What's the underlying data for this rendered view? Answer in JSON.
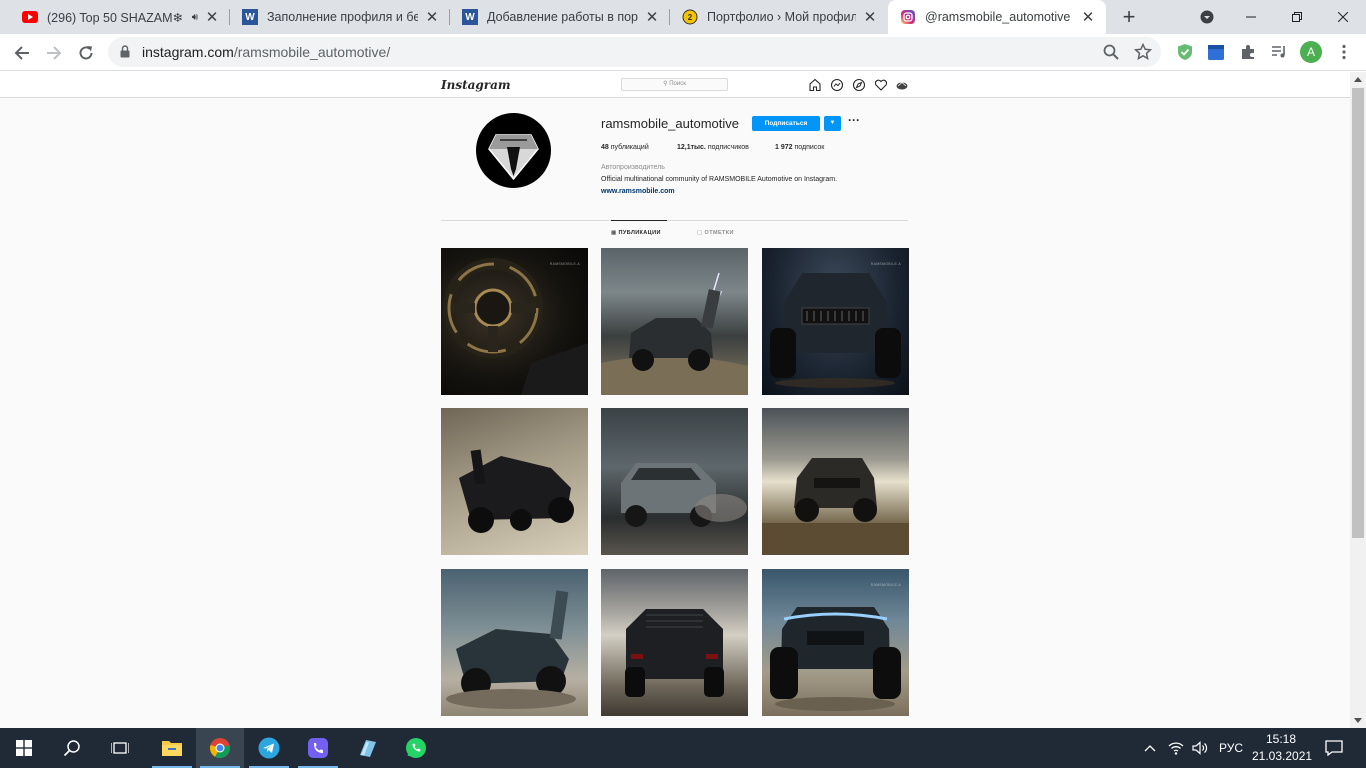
{
  "browser": {
    "tabs": [
      {
        "title": "(296) Top 50 SHAZAM❄",
        "favicon": "youtube-icon",
        "audio": true
      },
      {
        "title": "Заполнение профиля и бесплатная",
        "favicon": "word-icon"
      },
      {
        "title": "Добавление работы в портфолио",
        "favicon": "word-icon"
      },
      {
        "title": "Портфолио › Мой профиль",
        "favicon": "freelance-icon"
      },
      {
        "title": "@ramsmobile_automotive • Фото",
        "favicon": "instagram-icon",
        "active": true
      }
    ],
    "url_host": "instagram.com",
    "url_path": "/ramsmobile_automotive/",
    "profile_initial": "A"
  },
  "instagram": {
    "logo": "Instagram",
    "search_placeholder": "Поиск",
    "username": "ramsmobile_automotive",
    "follow_label": "Подписаться",
    "more_label": "···",
    "stats": {
      "posts_value": "48",
      "posts_label": "публикаций",
      "followers_value": "12,1тыс.",
      "followers_label": "подписчиков",
      "following_value": "1 972",
      "following_label": "подписок"
    },
    "category": "Автопроизводитель",
    "bio": "Official multinational community of RAMSMOBILE Automotive on Instagram.",
    "website": "www.ramsmobile.com",
    "tabs": {
      "posts": "ПУБЛИКАЦИИ",
      "tagged": "ОТМЕТКИ"
    },
    "watermark": "RAMSMOBILE.A",
    "posts": [
      {
        "subject": "steering-wheel"
      },
      {
        "subject": "offroad-vehicle-lightning"
      },
      {
        "subject": "offroad-vehicle-front"
      },
      {
        "subject": "offroad-vehicle-rear-desert"
      },
      {
        "subject": "offroad-vehicle-dust"
      },
      {
        "subject": "offroad-vehicle-field"
      },
      {
        "subject": "offroad-vehicle-doors-open"
      },
      {
        "subject": "offroad-vehicle-rear-dusk"
      },
      {
        "subject": "offroad-vehicle-headlights"
      }
    ]
  },
  "taskbar": {
    "apps": [
      "start-icon",
      "search-icon",
      "task-view-icon",
      "file-explorer-icon",
      "chrome-icon",
      "telegram-icon",
      "viber-icon",
      "notepad-icon",
      "whatsapp-icon"
    ],
    "language": "РУС",
    "time": "15:18",
    "date": "21.03.2021"
  },
  "colors": {
    "accent_blue": "#0095f6",
    "taskbar_bg": "#1f2a36",
    "tabstrip_bg": "#dee1e6"
  }
}
